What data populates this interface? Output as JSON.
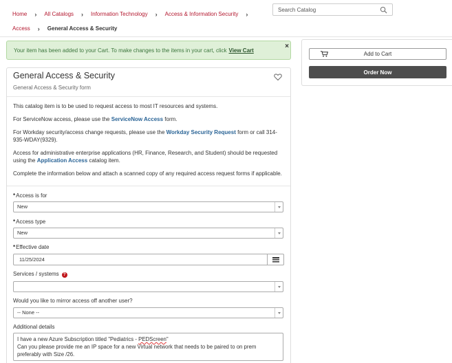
{
  "breadcrumb": {
    "items": [
      "Home",
      "All Catalogs",
      "Information Technology",
      "Access & Information Security",
      "Access"
    ],
    "current": "General Access & Security"
  },
  "search": {
    "placeholder": "Search Catalog"
  },
  "alert": {
    "message": "Your item has been added to your Cart. To make changes to the items in your cart, click",
    "link": "View Cart",
    "close": "×"
  },
  "item": {
    "title": "General Access & Security",
    "subtitle": "General Access & Security form"
  },
  "description": {
    "p1": "This catalog item is to be used to request access to most IT resources and systems.",
    "p2_pre": "For ServiceNow access, please use the ",
    "p2_link": "ServiceNow Access",
    "p2_post": " form.",
    "p3_pre": "For Workday security/access change requests, please use the ",
    "p3_link": "Workday Security Request",
    "p3_post": " form or call 314-935-WDAY(9329).",
    "p4_pre": "Access for administrative enterprise applications (HR, Finance, Research, and Student) should be requested using the ",
    "p4_link": "Application Access",
    "p4_post": " catalog item.",
    "p5": "Complete the information below and attach a scanned copy of any required access request forms if applicable."
  },
  "form": {
    "access_for": {
      "label": "Access is for",
      "value": "New"
    },
    "access_type": {
      "label": "Access type",
      "value": "New"
    },
    "effective_date": {
      "label": "Effective date",
      "value": "11/25/2024"
    },
    "services": {
      "label": "Services / systems",
      "value": ""
    },
    "mirror": {
      "label": "Would you like to mirror access off another user?",
      "value": "-- None --"
    },
    "details": {
      "label": "Additional details",
      "line1_pre": "I have a new Azure Subscription titled \"Pediatrics - ",
      "line1_squig": "PEDScreen",
      "line1_post": "\"",
      "line2": "Can you please provide me an IP space for a new Virtual network that needs to be paired to on prem",
      "line3": "preferably with Size /26."
    }
  },
  "sidebar": {
    "add_to_cart": "Add to Cart",
    "order_now": "Order Now"
  },
  "colors": {
    "breadcrumb_link": "#b3172e",
    "alert_bg": "#dff0d8",
    "alert_text": "#3c763d",
    "link_blue": "#2a6496",
    "order_button": "#4d4d4d",
    "help_icon": "#c0171c"
  }
}
